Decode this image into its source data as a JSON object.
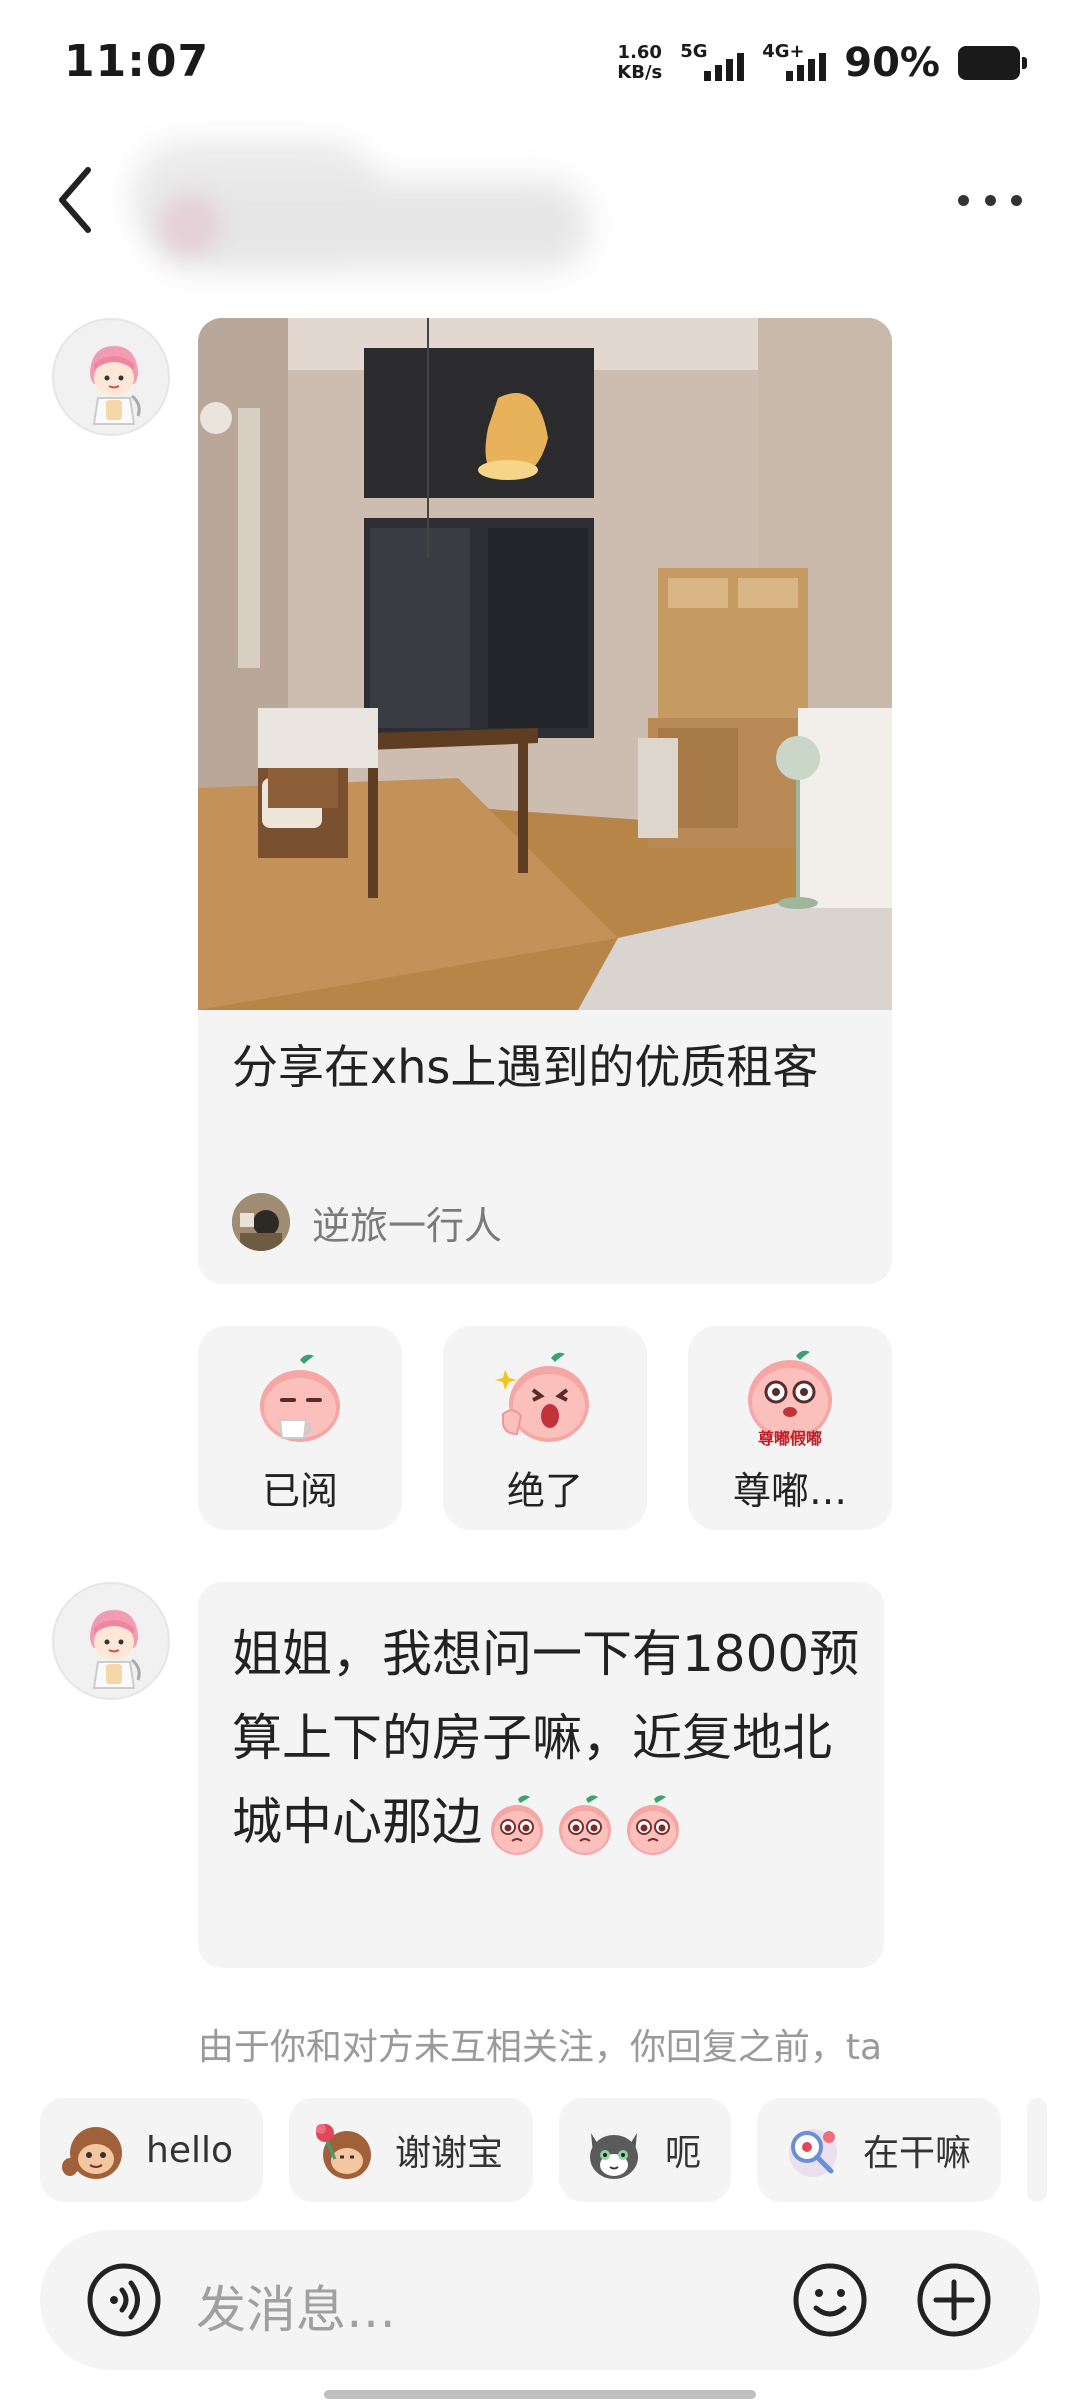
{
  "status_bar": {
    "time": "11:07",
    "net_speed_value": "1.60",
    "net_speed_unit": "KB/s",
    "sim1_tag": "5G",
    "sim2_tag": "4G+",
    "battery_percent": "90%",
    "battery_level": 0.9
  },
  "header": {
    "back_icon": "chevron-left-icon",
    "more_icon": "more-dots-icon"
  },
  "shared_note": {
    "title": "分享在xhs上遇到的优质租客",
    "author": "逆旅一行人"
  },
  "reactions": [
    {
      "label": "已阅",
      "sticker": "peach-reading-sticker"
    },
    {
      "label": "绝了",
      "sticker": "peach-amazed-sticker"
    },
    {
      "label": "尊嘟…",
      "sticker": "peach-shocked-sticker",
      "sticker_text": "尊嘟假嘟"
    }
  ],
  "message": {
    "text": "姐姐，我想问一下有1800预算上下的房子嘛，近复地北城中心那边",
    "trailing_emojis": [
      "peach-pleading-emoji",
      "peach-pleading-emoji",
      "peach-pleading-emoji"
    ]
  },
  "notice": "由于你和对方未互相关注，你回复之前，ta",
  "quick_replies": [
    {
      "label": "hello",
      "icon": "monkey-wave-icon"
    },
    {
      "label": "谢谢宝",
      "icon": "monkey-flower-icon"
    },
    {
      "label": "呃",
      "icon": "cat-icon"
    },
    {
      "label": "在干嘛",
      "icon": "magnifier-character-icon"
    }
  ],
  "input": {
    "placeholder": "发消息…",
    "voice_icon": "voice-icon",
    "emoji_icon": "smiley-icon",
    "plus_icon": "plus-circle-icon"
  },
  "colors": {
    "bubble_bg": "#f4f4f4",
    "text_primary": "#222222",
    "text_secondary": "#7a7a7a",
    "placeholder": "#a0a0a0"
  }
}
